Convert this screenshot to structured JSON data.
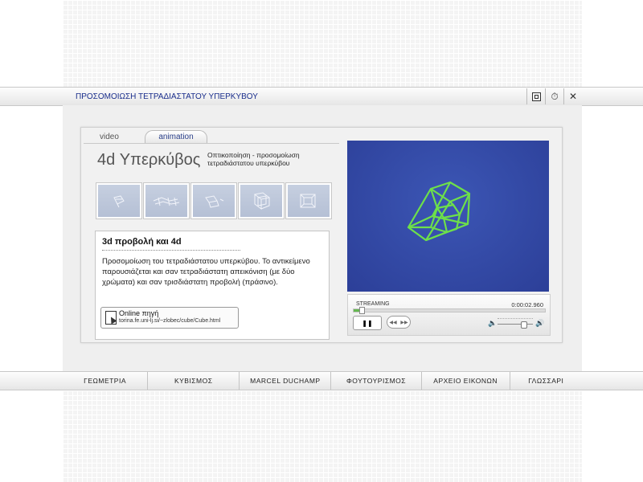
{
  "window": {
    "title": "ΠΡΟΣΟΜΟΙΩΣΗ ΤΕΤΡΑΔΙΑΣΤΑΤΟΥ ΥΠΕΡΚΥΒΟΥ"
  },
  "tabs": {
    "video": "video",
    "animation": "animation"
  },
  "header": {
    "title": "4d Υπερκύβος",
    "subtitle": "Οπτικοποίηση - προσομοίωση τετραδιάστατου υπερκύβου"
  },
  "description": {
    "title": "3d προβολή και 4d",
    "text": "Προσομοίωση του τετραδιάστατου υπερκύβου. Το αντικείμενο παρουσιάζεται και σαν τετραδιάστατη απεικόνιση (με δύο χρώματα) και σαν τρισδιάστατη προβολή (πράσινο).",
    "online_label": "Online πηγή",
    "online_url": "torina.fe.uni-lj.si/~zlobec/cube/Cube.html"
  },
  "player": {
    "status": "STREAMING",
    "time": "0:00:02.960",
    "progress": 0.04,
    "volume": 0.72
  },
  "nav": {
    "items": [
      "ΓΕΩΜΕΤΡΙΑ",
      "ΚΥΒΙΣΜΟΣ",
      "MARCEL DUCHAMP",
      "ΦΟΥΤΟΥΡΙΣΜΟΣ",
      "ΑΡΧΕΙΟ ΕΙΚΟΝΩΝ",
      "ΓΛΩΣΣΑΡΙ"
    ]
  },
  "colors": {
    "title_blue": "#1a2e8c",
    "video_bg": "#2c3f98",
    "cube_green": "#6de04a",
    "progress_green": "#66b852"
  }
}
